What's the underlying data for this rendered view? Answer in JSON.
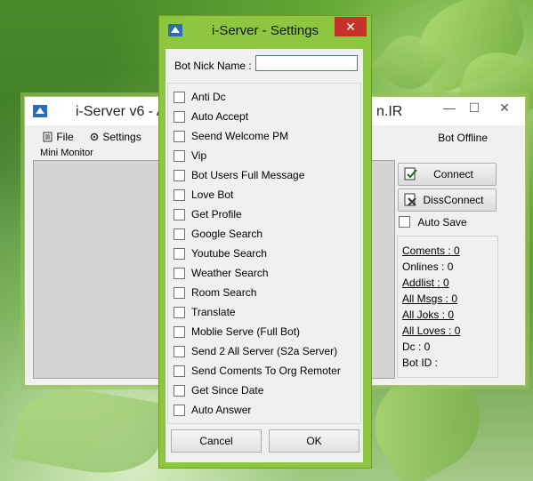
{
  "main_window": {
    "title": "i-Server v6 - A",
    "title_right": "n.IR",
    "controls": {
      "minimize": "—",
      "maximize": "☐",
      "close": "✕"
    },
    "menu": [
      {
        "label": "File",
        "icon": "file-icon"
      },
      {
        "label": "Settings",
        "icon": "gear-icon"
      }
    ],
    "status": "Bot Offline",
    "monitor_label": "Mini Monitor",
    "connect_label": "Connect",
    "disconnect_label": "DissConnect",
    "auto_save_label": "Auto Save",
    "stats": [
      {
        "label": "Coments : 0",
        "underline": true
      },
      {
        "label": "Onlines : 0",
        "underline": false
      },
      {
        "label": "Addlist : 0",
        "underline": true
      },
      {
        "label": "All Msgs : 0",
        "underline": true
      },
      {
        "label": "All Joks : 0",
        "underline": true
      },
      {
        "label": "All Loves : 0",
        "underline": true
      },
      {
        "label": "Dc : 0",
        "underline": false
      },
      {
        "label": "Bot ID :",
        "underline": false
      }
    ]
  },
  "settings_dialog": {
    "title": "i-Server - Settings",
    "close_label": "✕",
    "nick_label": "Bot Nick Name :",
    "nick_value": "",
    "options": [
      "Anti Dc",
      "Auto Accept",
      "Seend Welcome PM",
      "Vip",
      "Bot Users Full Message",
      "Love Bot",
      "Get Profile",
      "Google Search",
      "Youtube Search",
      "Weather Search",
      "Room Search",
      "Translate",
      "Moblie Serve (Full Bot)",
      "Send 2 All Server (S2a Server)",
      "Send Coments To Org Remoter",
      "Get Since Date",
      "Auto Answer"
    ],
    "cancel_label": "Cancel",
    "ok_label": "OK"
  }
}
